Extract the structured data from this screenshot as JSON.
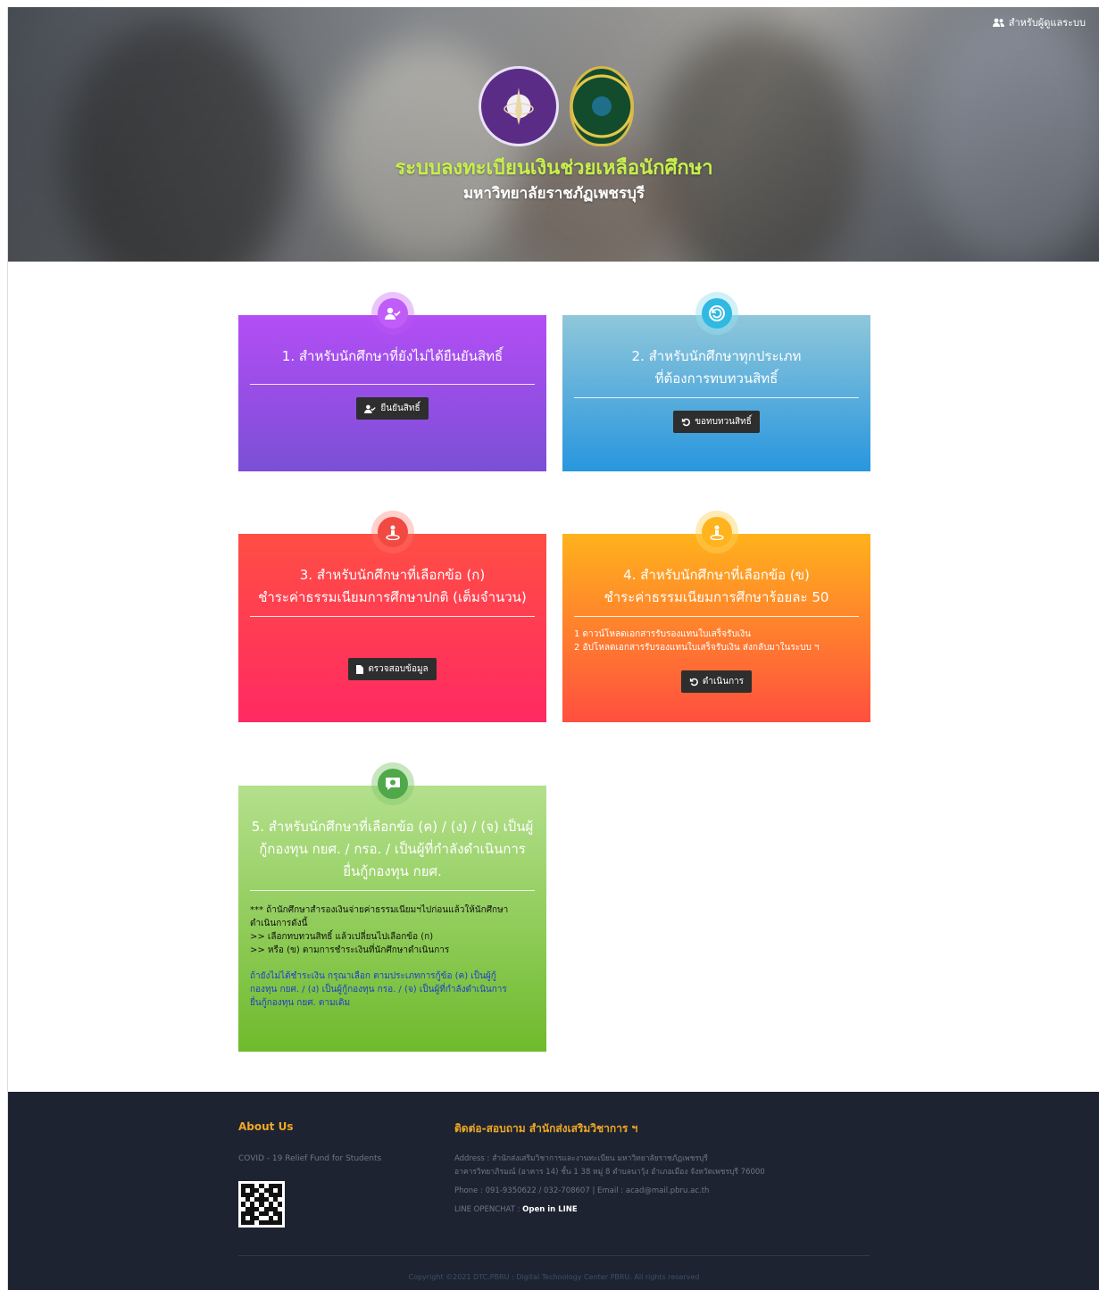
{
  "header": {
    "admin_link": "สำหรับผู้ดูแลระบบ",
    "title": "ระบบลงทะเบียนเงินช่วยเหลือนักศึกษา",
    "subtitle": "มหาวิทยาลัยราชภัฏเพชรบุรี"
  },
  "cards": [
    {
      "title_lines": [
        "1. สำหรับนักศึกษาที่ยังไม่ได้ยืนยันสิทธิ์"
      ],
      "button": "ยืนยันสิทธิ์",
      "icon": "user-check-icon",
      "color": "#b34ef5"
    },
    {
      "title_lines": [
        "2. สำหรับนักศึกษาทุกประเภท",
        "ที่ต้องการทบทวนสิทธิ์"
      ],
      "button": "ขอทบทวนสิทธิ์",
      "icon": "undo-icon",
      "color": "#2896de"
    },
    {
      "title_lines": [
        "3. สำหรับนักศึกษาที่เลือกข้อ (ก)",
        "ชำระค่าธรรมเนียมการศึกษาปกติ (เต็มจำนวน)"
      ],
      "button": "ตรวจสอบข้อมูล",
      "icon": "person-location-icon",
      "color": "#ff2a62"
    },
    {
      "title_lines": [
        "4. สำหรับนักศึกษาที่เลือกข้อ (ข)",
        "ชำระค่าธรรมเนียมการศึกษาร้อยละ 50"
      ],
      "body_lines": [
        "1 ดาวน์โหลดเอกสารรับรองแทนใบเสร็จรับเงิน",
        "2 อัปโหลดเอกสารรับรองแทนใบเสร็จรับเงิน ส่งกลับมาในระบบ ฯ"
      ],
      "button": "ดำเนินการ",
      "icon": "person-location-icon",
      "color": "#ffb21c"
    },
    {
      "title_lines": [
        "5. สำหรับนักศึกษาที่เลือกข้อ (ค) / (ง) / (จ) เป็นผู้",
        "กู้กองทุน กยศ. / กรอ. / เป็นผู้ที่กำลังดำเนินการ",
        "ยื่นกู้กองทุน กยศ."
      ],
      "body_lines": [
        "*** ถ้านักศึกษาสำรองเงินจ่ายค่าธรรมเนียมฯไปก่อนแล้วให้นักศึกษา",
        "ดำเนินการดังนี้",
        ">> เลือกทบทวนสิทธิ์ แล้วเปลี่ยนไปเลือกข้อ (ก)",
        ">> หรือ (ข) ตามการชำระเงินที่นักศึกษาดำเนินการ"
      ],
      "note_lines": [
        "ถ้ายังไม่ได้ชำระเงิน กรุณาเลือก ตามประเภทการกู้ข้อ (ค) เป็นผู้กู้",
        "กองทุน กยศ. / (ง) เป็นผู้กู้กองทุน กรอ. / (จ) เป็นผู้ที่กำลังดำเนินการ",
        "ยื่นกู้กองทุน กยศ. ตามเดิม"
      ],
      "icon": "money-chat-icon",
      "color": "#6fba2c"
    }
  ],
  "footer": {
    "about_title": "About Us",
    "about_text": "COVID - 19 Relief Fund for Students",
    "contact_title": "ติดต่อ-สอบถาม สำนักส่งเสริมวิชาการ ฯ",
    "address_line1": "Address : สำนักส่งเสริมวิชาการและงานทะเบียน มหาวิทยาลัยราชภัฏเพชรบุรี",
    "address_line2": "อาคารวิทยาภิรมณ์ (อาคาร 14) ชั้น 1 38 หมู่ 8 ตำบลนาวุ้ง อำเภอเมือง จังหวัดเพชรบุรี 76000",
    "phone_line": "Phone : 091-9350622 / 032-708607 | Email : acad@mail.pbru.ac.th",
    "line_label": "LINE OPENCHAT :",
    "line_link": "Open in LINE",
    "copyright": "Copyright ©2021 DTC.PBRU : Digital Technology Center PBRU. All rights reserved"
  }
}
